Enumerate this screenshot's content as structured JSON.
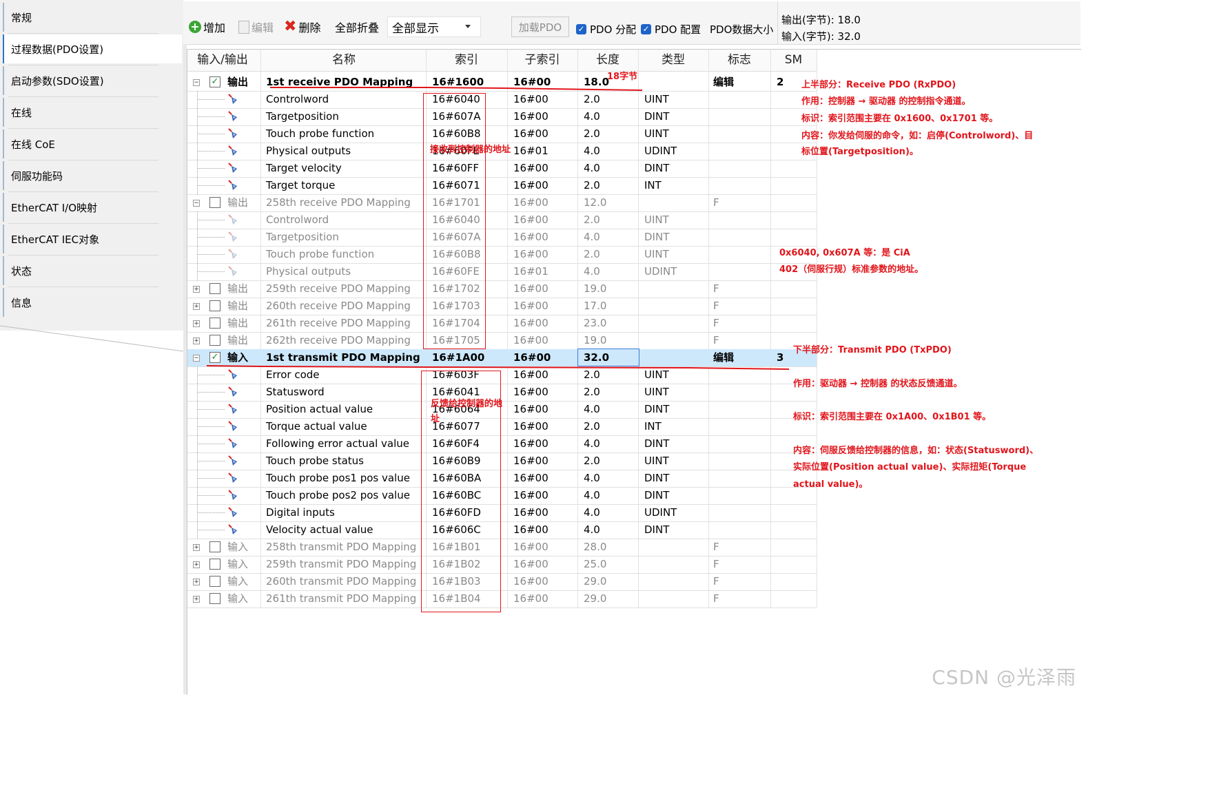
{
  "nav": {
    "items": [
      {
        "label": "常规",
        "selected": false
      },
      {
        "label": "过程数据(PDO设置)",
        "selected": true
      },
      {
        "label": "启动参数(SDO设置)",
        "selected": false
      },
      {
        "label": "在线",
        "selected": false
      },
      {
        "label": "在线 CoE",
        "selected": false
      },
      {
        "label": "伺服功能码",
        "selected": false
      },
      {
        "label": "EtherCAT I/O映射",
        "selected": false
      },
      {
        "label": "EtherCAT IEC对象",
        "selected": false
      },
      {
        "label": "状态",
        "selected": false
      },
      {
        "label": "信息",
        "selected": false
      }
    ]
  },
  "toolbar": {
    "add": "增加",
    "edit": "编辑",
    "delete": "删除",
    "collapse_all": "全部折叠",
    "display_select": "全部显示",
    "load_pdo": "加载PDO",
    "pdo_assign": "PDO 分配",
    "pdo_config": "PDO 配置",
    "pdo_size": "PDO数据大小",
    "output_bytes": "输出(字节): 18.0",
    "input_bytes": "输入(字节): 32.0"
  },
  "grid": {
    "headers": [
      "输入/输出",
      "名称",
      "索引",
      "子索引",
      "长度",
      "类型",
      "标志",
      "SM"
    ],
    "rows": [
      {
        "kind": "parent",
        "expanded": true,
        "checked": true,
        "style": "bold",
        "io": "输出",
        "name": "1st receive PDO Mapping",
        "index": "16#1600",
        "sub": "16#00",
        "len": "18.0",
        "type": "",
        "flag": "编辑",
        "sm": "2"
      },
      {
        "kind": "child",
        "style": "normal",
        "name": "Controlword",
        "index": "16#6040",
        "sub": "16#00",
        "len": "2.0",
        "type": "UINT"
      },
      {
        "kind": "child",
        "style": "normal",
        "name": "Targetposition",
        "index": "16#607A",
        "sub": "16#00",
        "len": "4.0",
        "type": "DINT"
      },
      {
        "kind": "child",
        "style": "normal",
        "name": "Touch probe function",
        "index": "16#60B8",
        "sub": "16#00",
        "len": "2.0",
        "type": "UINT"
      },
      {
        "kind": "child",
        "style": "normal",
        "name": "Physical outputs",
        "index": "16#60FE",
        "sub": "16#01",
        "len": "4.0",
        "type": "UDINT"
      },
      {
        "kind": "child",
        "style": "normal",
        "name": "Target velocity",
        "index": "16#60FF",
        "sub": "16#00",
        "len": "4.0",
        "type": "DINT"
      },
      {
        "kind": "child",
        "style": "normal",
        "name": "Target torque",
        "index": "16#6071",
        "sub": "16#00",
        "len": "2.0",
        "type": "INT"
      },
      {
        "kind": "parent",
        "expanded": true,
        "checked": false,
        "style": "gray",
        "io": "输出",
        "name": "258th receive PDO Mapping",
        "index": "16#1701",
        "sub": "16#00",
        "len": "12.0",
        "type": "",
        "flag": "F",
        "sm": ""
      },
      {
        "kind": "child",
        "style": "gray",
        "name": "Controlword",
        "index": "16#6040",
        "sub": "16#00",
        "len": "2.0",
        "type": "UINT"
      },
      {
        "kind": "child",
        "style": "gray",
        "name": "Targetposition",
        "index": "16#607A",
        "sub": "16#00",
        "len": "4.0",
        "type": "DINT"
      },
      {
        "kind": "child",
        "style": "gray",
        "name": "Touch probe function",
        "index": "16#60B8",
        "sub": "16#00",
        "len": "2.0",
        "type": "UINT"
      },
      {
        "kind": "child",
        "style": "gray",
        "name": "Physical outputs",
        "index": "16#60FE",
        "sub": "16#01",
        "len": "4.0",
        "type": "UDINT"
      },
      {
        "kind": "parent",
        "expanded": false,
        "checked": false,
        "style": "gray",
        "io": "输出",
        "name": "259th receive PDO Mapping",
        "index": "16#1702",
        "sub": "16#00",
        "len": "19.0",
        "type": "",
        "flag": "F",
        "sm": ""
      },
      {
        "kind": "parent",
        "expanded": false,
        "checked": false,
        "style": "gray",
        "io": "输出",
        "name": "260th receive PDO Mapping",
        "index": "16#1703",
        "sub": "16#00",
        "len": "17.0",
        "type": "",
        "flag": "F",
        "sm": ""
      },
      {
        "kind": "parent",
        "expanded": false,
        "checked": false,
        "style": "gray",
        "io": "输出",
        "name": "261th receive PDO Mapping",
        "index": "16#1704",
        "sub": "16#00",
        "len": "23.0",
        "type": "",
        "flag": "F",
        "sm": ""
      },
      {
        "kind": "parent",
        "expanded": false,
        "checked": false,
        "style": "gray",
        "io": "输出",
        "name": "262th receive PDO Mapping",
        "index": "16#1705",
        "sub": "16#00",
        "len": "19.0",
        "type": "",
        "flag": "F",
        "sm": ""
      },
      {
        "kind": "parent",
        "expanded": true,
        "checked": true,
        "style": "bold",
        "selected": true,
        "io": "输入",
        "name": "1st transmit PDO Mapping",
        "index": "16#1A00",
        "sub": "16#00",
        "len": "32.0",
        "type": "",
        "flag": "编辑",
        "sm": "3"
      },
      {
        "kind": "child",
        "style": "normal",
        "name": "Error code",
        "index": "16#603F",
        "sub": "16#00",
        "len": "2.0",
        "type": "UINT"
      },
      {
        "kind": "child",
        "style": "normal",
        "name": "Statusword",
        "index": "16#6041",
        "sub": "16#00",
        "len": "2.0",
        "type": "UINT"
      },
      {
        "kind": "child",
        "style": "normal",
        "name": "Position actual value",
        "index": "16#6064",
        "sub": "16#00",
        "len": "4.0",
        "type": "DINT"
      },
      {
        "kind": "child",
        "style": "normal",
        "name": "Torque actual value",
        "index": "16#6077",
        "sub": "16#00",
        "len": "2.0",
        "type": "INT"
      },
      {
        "kind": "child",
        "style": "normal",
        "name": "Following error actual value",
        "index": "16#60F4",
        "sub": "16#00",
        "len": "4.0",
        "type": "DINT"
      },
      {
        "kind": "child",
        "style": "normal",
        "name": "Touch probe status",
        "index": "16#60B9",
        "sub": "16#00",
        "len": "2.0",
        "type": "UINT"
      },
      {
        "kind": "child",
        "style": "normal",
        "name": "Touch probe pos1 pos value",
        "index": "16#60BA",
        "sub": "16#00",
        "len": "4.0",
        "type": "DINT"
      },
      {
        "kind": "child",
        "style": "normal",
        "name": "Touch probe pos2 pos value",
        "index": "16#60BC",
        "sub": "16#00",
        "len": "4.0",
        "type": "DINT"
      },
      {
        "kind": "child",
        "style": "normal",
        "name": "Digital inputs",
        "index": "16#60FD",
        "sub": "16#00",
        "len": "4.0",
        "type": "UDINT"
      },
      {
        "kind": "child",
        "style": "normal",
        "name": "Velocity actual value",
        "index": "16#606C",
        "sub": "16#00",
        "len": "4.0",
        "type": "DINT"
      },
      {
        "kind": "parent",
        "expanded": false,
        "checked": false,
        "style": "gray",
        "io": "输入",
        "name": "258th transmit PDO Mapping",
        "index": "16#1B01",
        "sub": "16#00",
        "len": "28.0",
        "type": "",
        "flag": "F",
        "sm": ""
      },
      {
        "kind": "parent",
        "expanded": false,
        "checked": false,
        "style": "gray",
        "io": "输入",
        "name": "259th transmit PDO Mapping",
        "index": "16#1B02",
        "sub": "16#00",
        "len": "25.0",
        "type": "",
        "flag": "F",
        "sm": ""
      },
      {
        "kind": "parent",
        "expanded": false,
        "checked": false,
        "style": "gray",
        "io": "输入",
        "name": "260th transmit PDO Mapping",
        "index": "16#1B03",
        "sub": "16#00",
        "len": "29.0",
        "type": "",
        "flag": "F",
        "sm": ""
      },
      {
        "kind": "parent",
        "expanded": false,
        "checked": false,
        "style": "gray",
        "io": "输入",
        "name": "261th transmit PDO Mapping",
        "index": "16#1B04",
        "sub": "16#00",
        "len": "29.0",
        "type": "",
        "flag": "F",
        "sm": ""
      }
    ]
  },
  "annotations": {
    "bytes18": "18字节",
    "recv_addr": "接收到控制器的地址",
    "feedback_addr_1": "反馈给控制器的地",
    "feedback_addr_2": "址",
    "upper_title": "上半部分：Receive PDO (RxPDO)",
    "upper_use": "作用：控制器 → 驱动器 的控制指令通道。",
    "upper_id": "标识：索引范围主要在 0x1600、0x1701 等。",
    "upper_content_1": "内容：你发给伺服的命令，如：启停(Controlword)、目",
    "upper_content_2": "标位置(Targetposition)。",
    "cia_1": "0x6040, 0x607A 等：是 CiA",
    "cia_2": "402（伺服行规）标准参数的地址。",
    "lower_title": "下半部分：Transmit PDO (TxPDO)",
    "lower_use": "作用：驱动器 → 控制器 的状态反馈通道。",
    "lower_id": "标识：索引范围主要在 0x1A00、0x1B01 等。",
    "lower_content_1": "内容：伺服反馈给控制器的信息，如：状态(Statusword)、",
    "lower_content_2": "实际位置(Position actual value)、实际扭矩(Torque",
    "lower_content_3": "actual value)。"
  },
  "watermark": "CSDN @光泽雨",
  "colors": {
    "accent": "#1e63c9",
    "annotation": "#e1151b",
    "selected_row": "#cde8fb"
  }
}
